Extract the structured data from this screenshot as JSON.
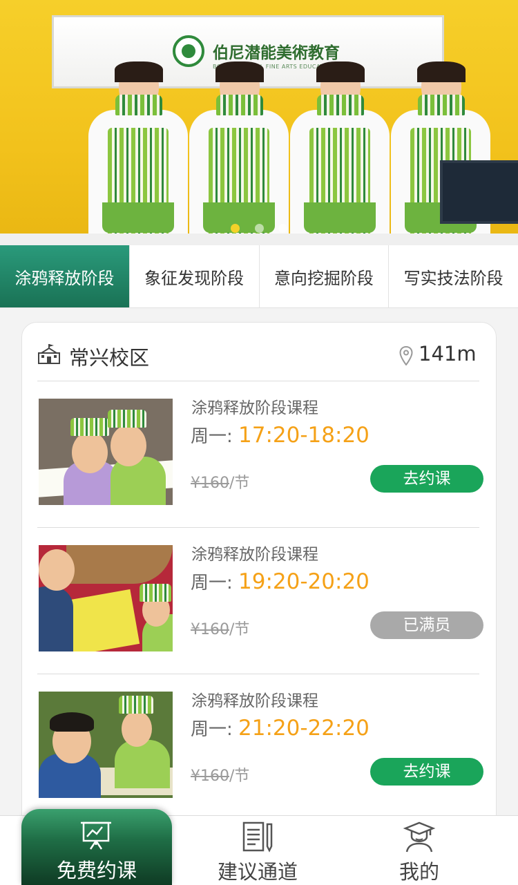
{
  "banner": {
    "sign_title": "伯尼潜能美術教育",
    "sign_subtitle": "BONI POTENTIAL FINE ARTS EDUCATION",
    "slide_count": 3,
    "active_slide": 1
  },
  "tabs": [
    {
      "label": "涂鸦释放阶段",
      "active": true
    },
    {
      "label": "象征发现阶段",
      "active": false
    },
    {
      "label": "意向挖掘阶段",
      "active": false
    },
    {
      "label": "写实技法阶段",
      "active": false
    }
  ],
  "campus": {
    "icon": "school-icon",
    "name": "常兴校区",
    "location_icon": "location-pin-icon",
    "distance": "141m"
  },
  "courses": [
    {
      "title": "涂鸦释放阶段课程",
      "day_label": "周一:",
      "time": "17:20-18:20",
      "currency": "¥",
      "price": "160",
      "unit": "/节",
      "button": "去约课",
      "status": "available"
    },
    {
      "title": "涂鸦释放阶段课程",
      "day_label": "周一:",
      "time": "19:20-20:20",
      "currency": "¥",
      "price": "160",
      "unit": "/节",
      "button": "已满员",
      "status": "full"
    },
    {
      "title": "涂鸦释放阶段课程",
      "day_label": "周一:",
      "time": "21:20-22:20",
      "currency": "¥",
      "price": "160",
      "unit": "/节",
      "button": "去约课",
      "status": "available"
    }
  ],
  "bottom_nav": [
    {
      "label": "免费约课",
      "icon": "presentation-board-icon",
      "active": true
    },
    {
      "label": "建议通道",
      "icon": "document-pen-icon",
      "active": false
    },
    {
      "label": "我的",
      "icon": "graduate-profile-icon",
      "active": false
    }
  ],
  "colors": {
    "accent_green": "#1aa55a",
    "tab_active": "#1a7255",
    "time_orange": "#f5a117",
    "disabled_gray": "#a9a9a9"
  }
}
